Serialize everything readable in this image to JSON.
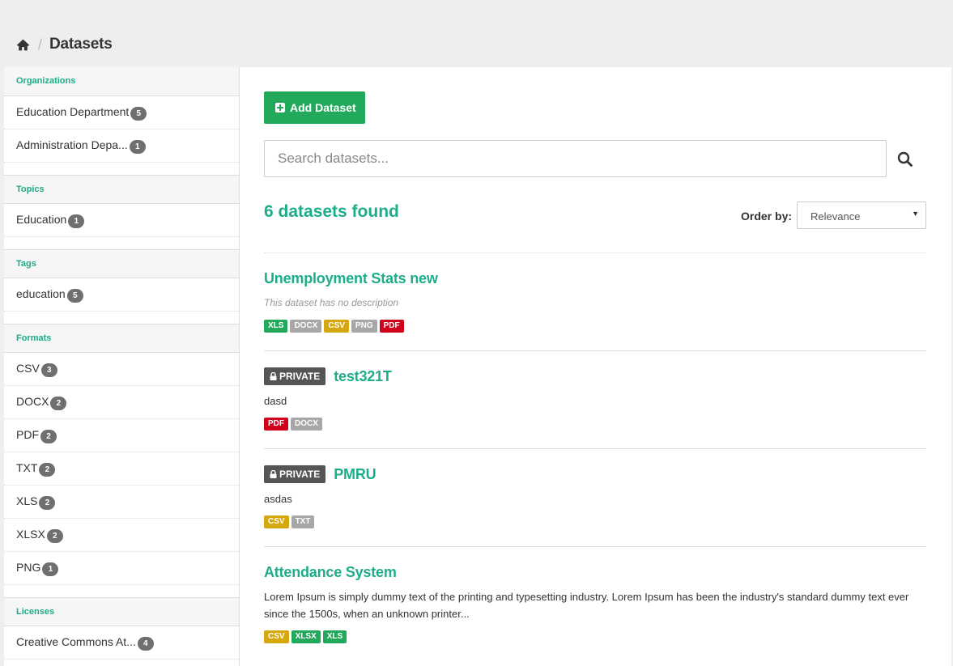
{
  "breadcrumb": {
    "home_icon": "home-icon",
    "separator": "/",
    "current": "Datasets"
  },
  "sidebar": {
    "facets": [
      {
        "title": "Organizations",
        "items": [
          {
            "label": "Education Department",
            "count": "5"
          },
          {
            "label": "Administration Depa...",
            "count": "1"
          }
        ]
      },
      {
        "title": "Topics",
        "items": [
          {
            "label": "Education",
            "count": "1"
          }
        ]
      },
      {
        "title": "Tags",
        "items": [
          {
            "label": "education",
            "count": "5"
          }
        ]
      },
      {
        "title": "Formats",
        "items": [
          {
            "label": "CSV",
            "count": "3"
          },
          {
            "label": "DOCX",
            "count": "2"
          },
          {
            "label": "PDF",
            "count": "2"
          },
          {
            "label": "TXT",
            "count": "2"
          },
          {
            "label": "XLS",
            "count": "2"
          },
          {
            "label": "XLSX",
            "count": "2"
          },
          {
            "label": "PNG",
            "count": "1"
          }
        ]
      },
      {
        "title": "Licenses",
        "items": [
          {
            "label": "Creative Commons At...",
            "count": "4"
          }
        ]
      }
    ]
  },
  "main": {
    "add_button": "Add Dataset",
    "search": {
      "placeholder": "Search datasets..."
    },
    "found_text": "6 datasets found",
    "order": {
      "label": "Order by:",
      "selected": "Relevance"
    },
    "datasets": [
      {
        "private": false,
        "title": "Unemployment Stats new",
        "description": "This dataset has no description",
        "no_description": true,
        "formats": [
          "XLS",
          "DOCX",
          "CSV",
          "PNG",
          "PDF"
        ]
      },
      {
        "private": true,
        "private_label": "PRIVATE",
        "title": "test321T",
        "description": "dasd",
        "formats": [
          "PDF",
          "DOCX"
        ]
      },
      {
        "private": true,
        "private_label": "PRIVATE",
        "title": "PMRU",
        "description": "asdas",
        "formats": [
          "CSV",
          "TXT"
        ]
      },
      {
        "private": false,
        "title": "Attendance System",
        "description": "Lorem Ipsum is simply dummy text of the printing and typesetting industry. Lorem Ipsum has been the industry's standard dummy text ever since the 1500s, when an unknown printer...",
        "formats": [
          "CSV",
          "XLSX",
          "XLS"
        ]
      }
    ]
  },
  "colors": {
    "accent": "#1ead8a",
    "button_green": "#23a95b",
    "private_badge": "#555555"
  }
}
